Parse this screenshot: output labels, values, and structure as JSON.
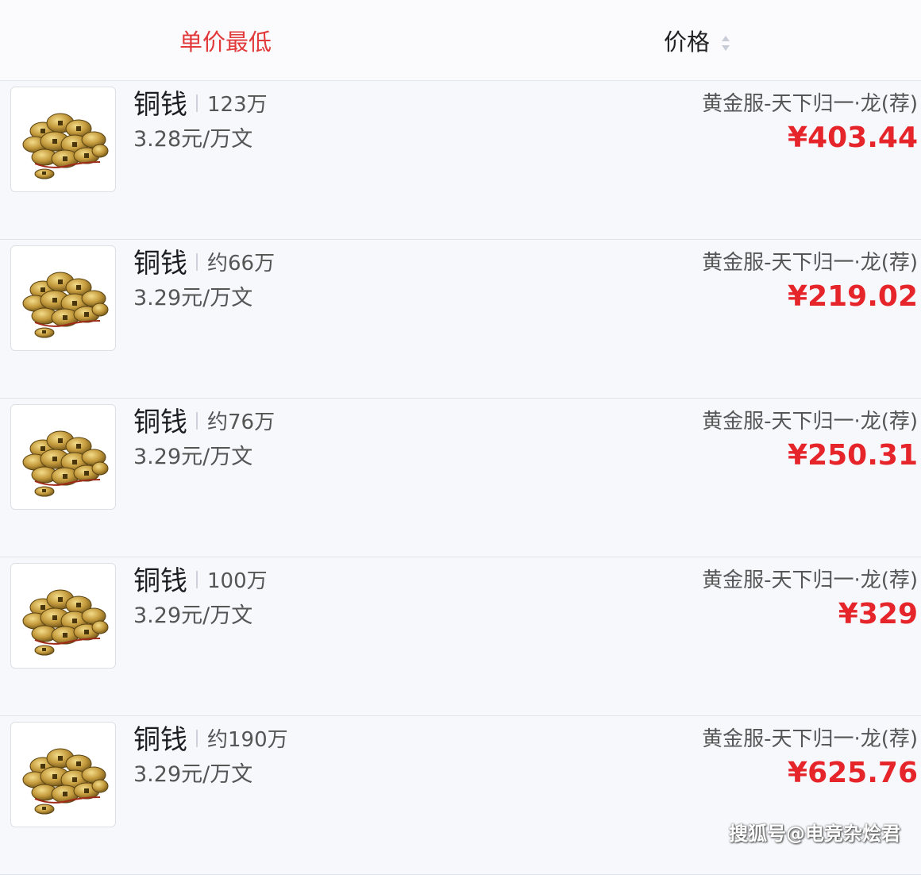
{
  "header": {
    "tab_unit_price": "单价最低",
    "tab_price": "价格"
  },
  "items": [
    {
      "name": "铜钱",
      "quantity": "123万",
      "unit_price": "3.28元/万文",
      "server": "黄金服-天下归一·龙(荐)",
      "price": "¥403.44",
      "icon": "copper-coins-icon"
    },
    {
      "name": "铜钱",
      "quantity": "约66万",
      "unit_price": "3.29元/万文",
      "server": "黄金服-天下归一·龙(荐)",
      "price": "¥219.02",
      "icon": "copper-coins-icon"
    },
    {
      "name": "铜钱",
      "quantity": "约76万",
      "unit_price": "3.29元/万文",
      "server": "黄金服-天下归一·龙(荐)",
      "price": "¥250.31",
      "icon": "copper-coins-icon"
    },
    {
      "name": "铜钱",
      "quantity": "100万",
      "unit_price": "3.29元/万文",
      "server": "黄金服-天下归一·龙(荐)",
      "price": "¥329",
      "icon": "copper-coins-icon"
    },
    {
      "name": "铜钱",
      "quantity": "约190万",
      "unit_price": "3.29元/万文",
      "server": "黄金服-天下归一·龙(荐)",
      "price": "¥625.76",
      "icon": "copper-coins-icon"
    }
  ],
  "watermark": "搜狐号@电竞杂烩君",
  "colors": {
    "accent_red": "#e5252a",
    "tab_active": "#e23a3a",
    "background": "#f7f8fc"
  }
}
